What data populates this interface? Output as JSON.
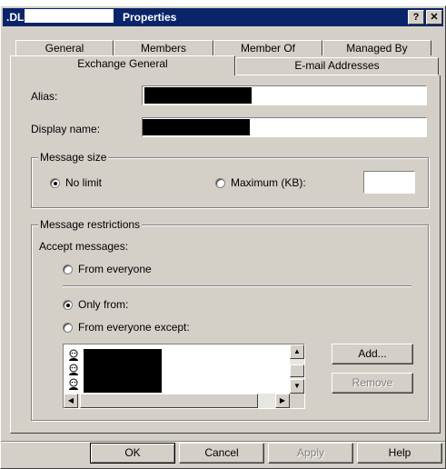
{
  "window": {
    "title_prefix": ".DL",
    "title": "Properties",
    "help_btn": "?",
    "close_btn": "✕"
  },
  "tabs_row1": [
    "General",
    "Members",
    "Member Of",
    "Managed By"
  ],
  "tabs_row2": [
    "Exchange General",
    "E-mail Addresses"
  ],
  "form": {
    "alias_label": "Alias:",
    "display_name_label": "Display name:"
  },
  "message_size": {
    "group_title": "Message size",
    "no_limit": "No limit",
    "maximum": "Maximum (KB):",
    "selected": "no_limit"
  },
  "restrictions": {
    "group_title": "Message restrictions",
    "accept_label": "Accept messages:",
    "from_everyone": "From everyone",
    "only_from": "Only from:",
    "from_everyone_except": "From everyone except:",
    "selected": "only_from",
    "add_button": "Add...",
    "remove_button": "Remove"
  },
  "footer": {
    "ok": "OK",
    "cancel": "Cancel",
    "apply": "Apply",
    "help": "Help"
  },
  "colors": {
    "titlebar": "#0a246a",
    "face": "#d4d0c8"
  }
}
